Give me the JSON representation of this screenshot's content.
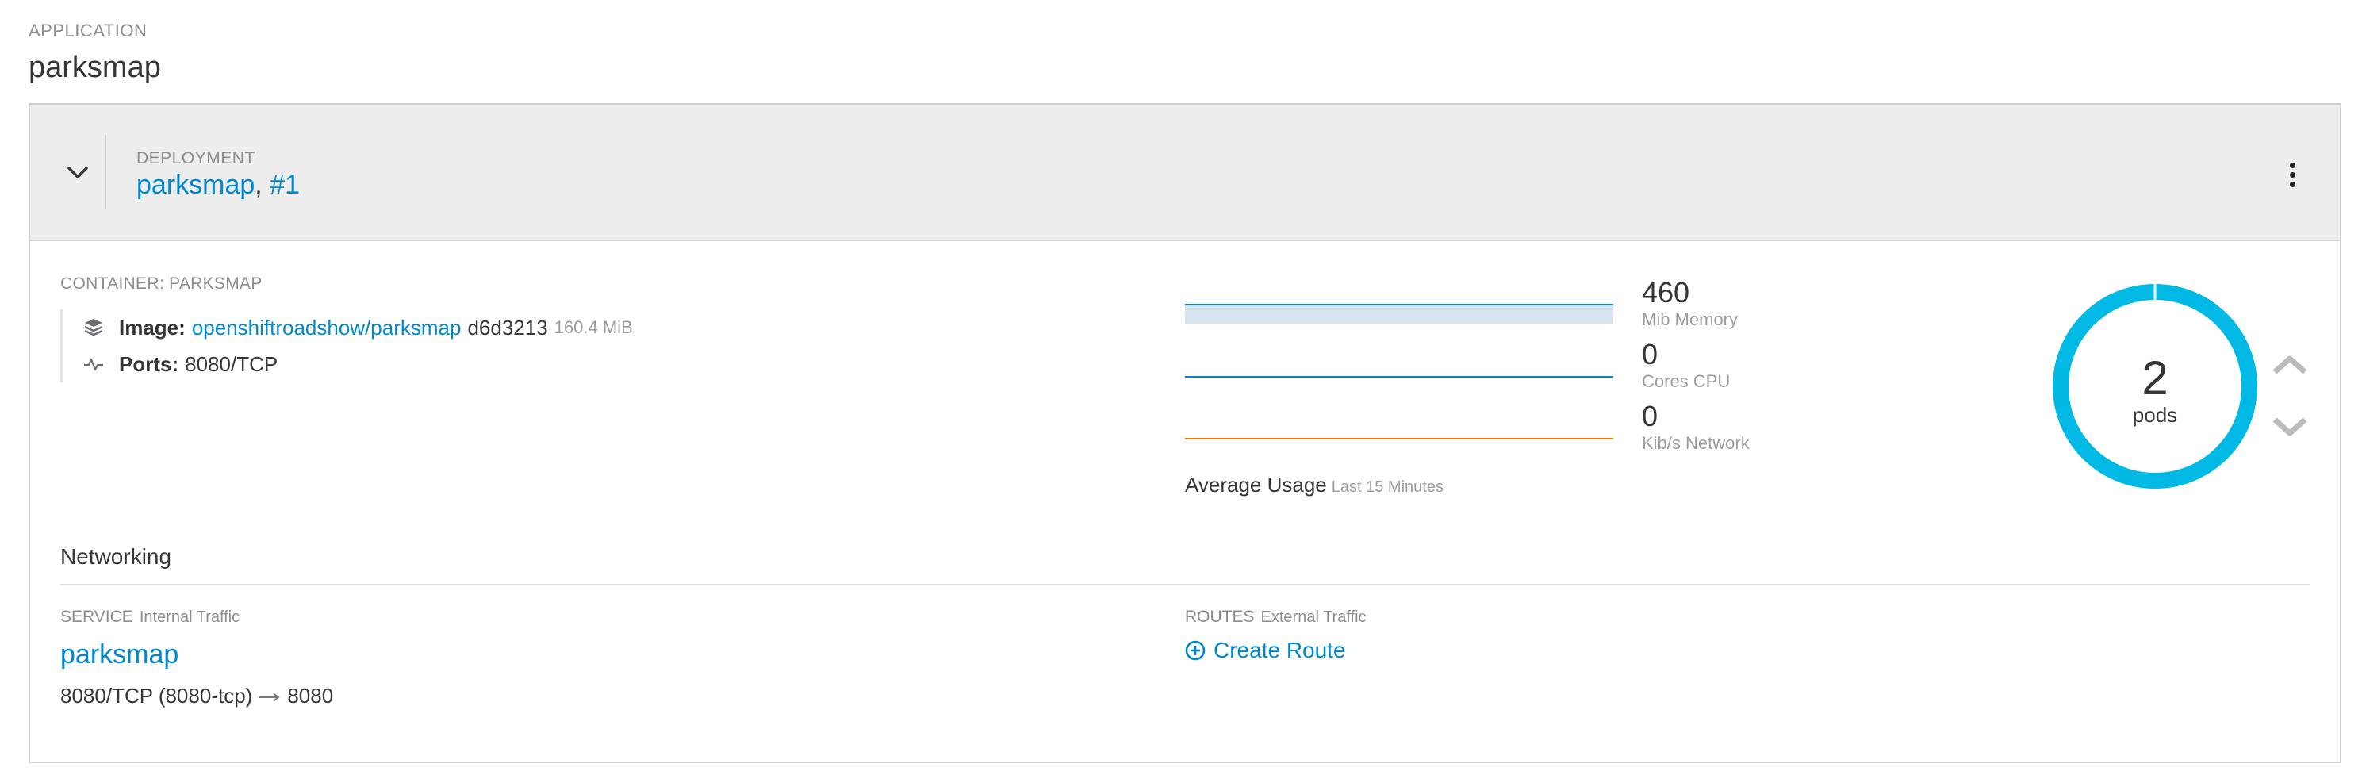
{
  "app": {
    "kicker": "APPLICATION",
    "title": "parksmap"
  },
  "deployment": {
    "kicker": "DEPLOYMENT",
    "name": "parksmap",
    "separator": ", ",
    "revision": "#1"
  },
  "container": {
    "kicker": "CONTAINER: PARKSMAP",
    "image_label": "Image:",
    "image_link": "openshiftroadshow/parksmap",
    "image_id": "d6d3213",
    "image_size": "160.4 MiB",
    "ports_label": "Ports:",
    "ports_value": "8080/TCP"
  },
  "metrics": {
    "memory": {
      "value": "460",
      "label": "Mib Memory",
      "color": "#0088ce",
      "fill": "#d7e4ef"
    },
    "cpu": {
      "value": "0",
      "label": "Cores CPU",
      "color": "#0088ce"
    },
    "network": {
      "value": "0",
      "label": "Kib/s Network",
      "color": "#ec7a08"
    },
    "avg_label": "Average Usage",
    "avg_range": "Last 15 Minutes"
  },
  "pods": {
    "count": "2",
    "label": "pods",
    "ring_color": "#00b9e4"
  },
  "networking": {
    "title": "Networking",
    "service_kicker": "SERVICE",
    "service_sub": "Internal Traffic",
    "service_name": "parksmap",
    "service_port_from": "8080/TCP (8080-tcp)",
    "service_port_to": "8080",
    "routes_kicker": "ROUTES",
    "routes_sub": "External Traffic",
    "create_route": "Create Route"
  },
  "icons": {
    "collapse": "chevron-down-icon",
    "menu": "kebab-icon",
    "image": "layers-icon",
    "ports": "pulse-icon",
    "scale_up": "chevron-up-icon",
    "scale_down": "chevron-down-icon",
    "route": "plus-circle-icon",
    "arrow": "long-arrow-right-icon"
  }
}
